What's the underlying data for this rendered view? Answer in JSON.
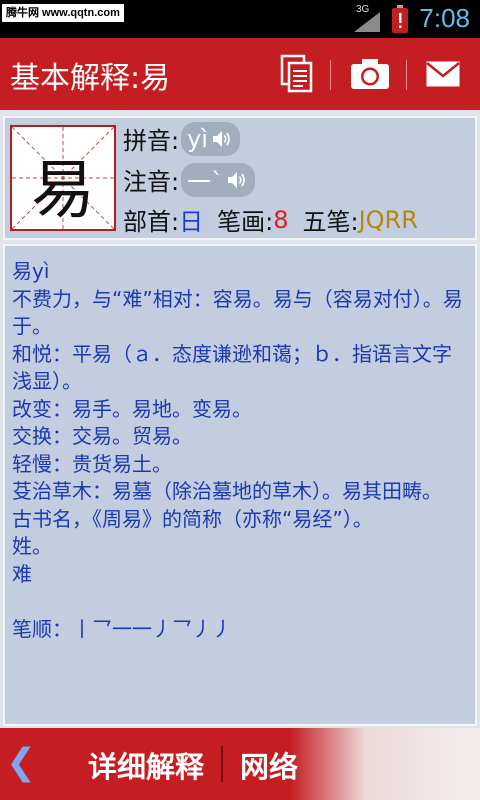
{
  "status_bar": {
    "watermark": "腾牛网 www.qqtn.com",
    "network": "3G",
    "time": "7:08"
  },
  "header": {
    "title": "基本解释:易",
    "icons": [
      "copy-icon",
      "camera-icon",
      "mail-icon"
    ]
  },
  "entry": {
    "character": "易",
    "pinyin_label": "拼音:",
    "pinyin": "yì",
    "zhuyin_label": "注音:",
    "zhuyin": "一ˋ",
    "radical_label": "部首:",
    "radical": "日",
    "strokes_label": "笔画:",
    "strokes": "8",
    "wubi_label": "五笔:",
    "wubi": "JQRR"
  },
  "colors": {
    "accent": "#c41e22",
    "panel": "#c3cde0",
    "text_blue": "#1c39b0"
  },
  "definition": "易yì\n不费力，与“难”相对：容易。易与（容易对付）。易于。\n和悦：平易（ａ．态度谦逊和蔼；ｂ．指语言文字浅显）。\n改变：易手。易地。变易。\n交换：交易。贸易。\n轻慢：贵货易土。\n芟治草木：易墓（除治墓地的草木）。易其田畴。\n古书名，《周易》的简称（亦称“易经”）。\n姓。\n难\n\n笔顺：丨乛一一丿乛丿丿",
  "bottom_bar": {
    "back": "❮",
    "tab_detail": "详细解释",
    "tab_network": "网络"
  }
}
